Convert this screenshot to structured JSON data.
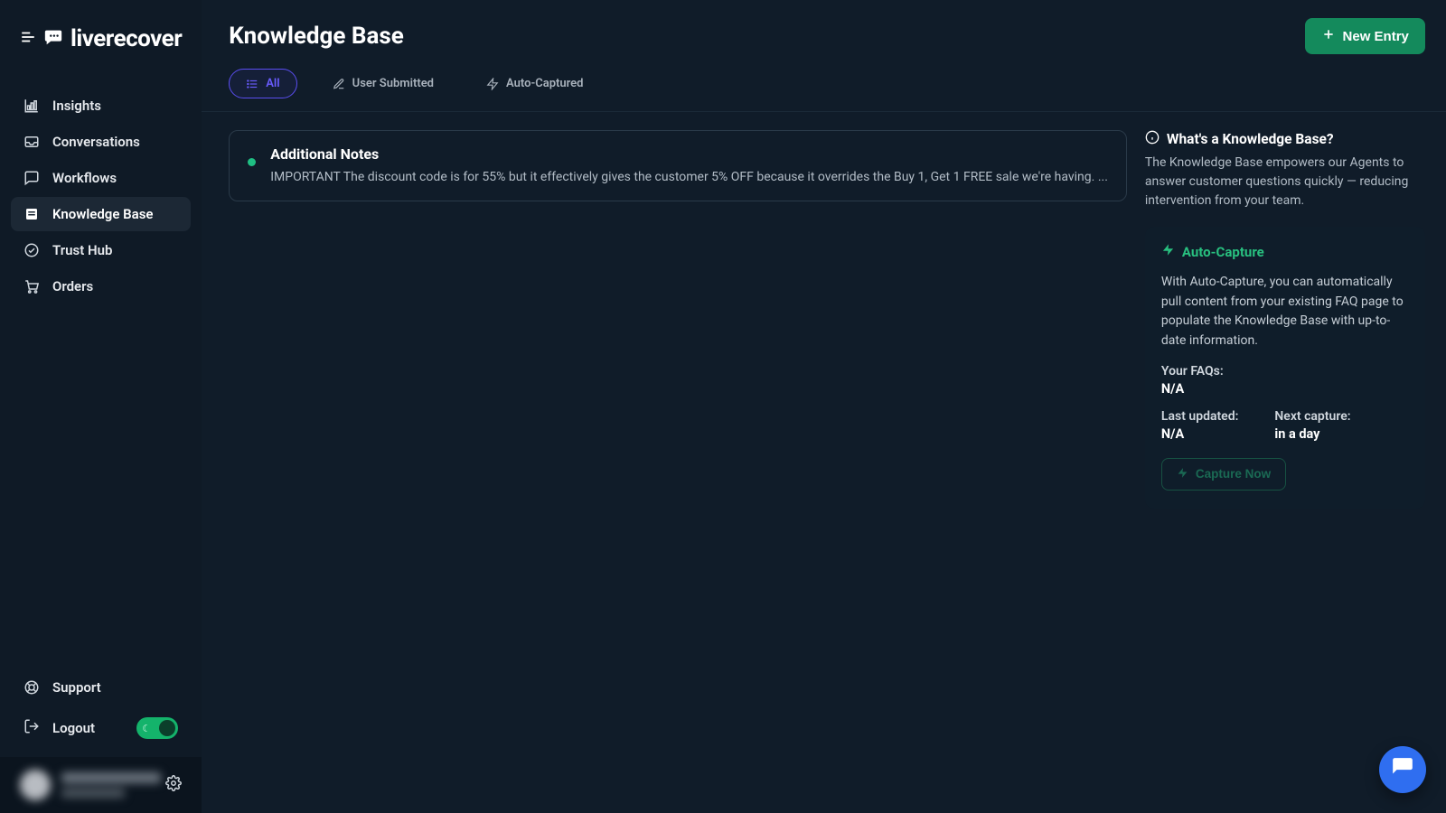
{
  "brand": "liverecover",
  "sidebar": {
    "items": [
      {
        "label": "Insights",
        "icon": "chart"
      },
      {
        "label": "Conversations",
        "icon": "inbox"
      },
      {
        "label": "Workflows",
        "icon": "message"
      },
      {
        "label": "Knowledge Base",
        "icon": "book",
        "active": true
      },
      {
        "label": "Trust Hub",
        "icon": "check-circle"
      },
      {
        "label": "Orders",
        "icon": "cart"
      }
    ],
    "support_label": "Support",
    "logout_label": "Logout"
  },
  "header": {
    "title": "Knowledge Base",
    "new_entry_label": "New Entry"
  },
  "tabs": [
    {
      "id": "all",
      "label": "All",
      "icon": "list",
      "active": true
    },
    {
      "id": "user",
      "label": "User Submitted",
      "icon": "pencil"
    },
    {
      "id": "auto",
      "label": "Auto-Captured",
      "icon": "bolt"
    }
  ],
  "entries": [
    {
      "title": "Additional Notes",
      "body": "IMPORTANT The discount code is for 55% but it effectively gives the customer 5% OFF because it overrides the Buy 1, Get 1 FREE sale we're having. ..."
    }
  ],
  "info": {
    "heading": "What's a Knowledge Base?",
    "desc": "The Knowledge Base empowers our Agents to answer customer questions quickly — reducing intervention from your team."
  },
  "auto_capture": {
    "title": "Auto-Capture",
    "desc": "With Auto-Capture, you can automatically pull content from your existing FAQ page to populate the Knowledge Base with up-to-date information.",
    "faqs_label": "Your FAQs:",
    "faqs_value": "N/A",
    "last_updated_label": "Last updated:",
    "last_updated_value": "N/A",
    "next_capture_label": "Next capture:",
    "next_capture_value": "in a day",
    "capture_now_label": "Capture Now"
  }
}
